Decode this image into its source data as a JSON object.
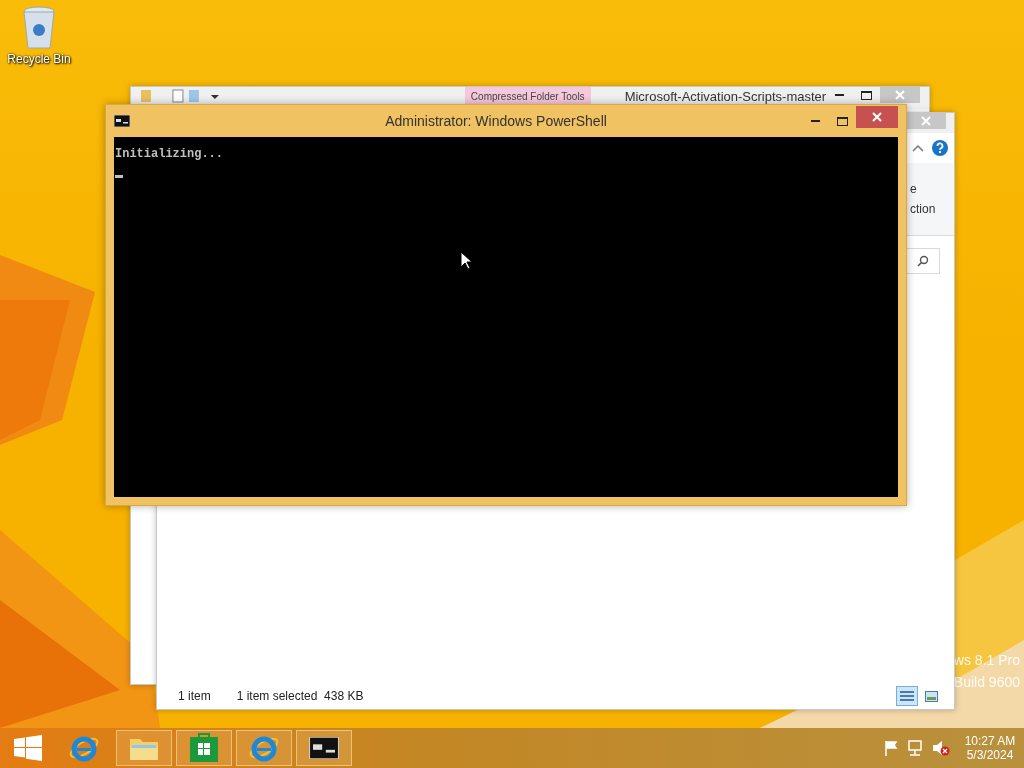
{
  "desktop_icons": [
    {
      "label": "Recycle Bin",
      "kind": "recycle"
    }
  ],
  "windows": [
    {
      "kind": "explorer",
      "context_tab": "Compressed Folder Tools",
      "title": "Microsoft-Activation-Scripts-master"
    },
    {
      "kind": "explorer",
      "ribbon_labels": [
        "e",
        "ction"
      ],
      "status_items": [
        "1 item",
        "1 item selected  438 KB"
      ]
    },
    {
      "kind": "console",
      "title": "Administrator: Windows PowerShell",
      "lines": [
        "Initializing..."
      ]
    }
  ],
  "watermark": [
    "ws 8.1 Pro",
    "Build 9600"
  ],
  "taskbar": {
    "apps": [
      {
        "kind": "ie",
        "running": false
      },
      {
        "kind": "folder",
        "running": true
      },
      {
        "kind": "store",
        "running": true
      },
      {
        "kind": "ie",
        "running": true
      },
      {
        "kind": "console",
        "running": true
      }
    ]
  },
  "clock": {
    "time": "10:27 AM",
    "date": "5/3/2024"
  }
}
